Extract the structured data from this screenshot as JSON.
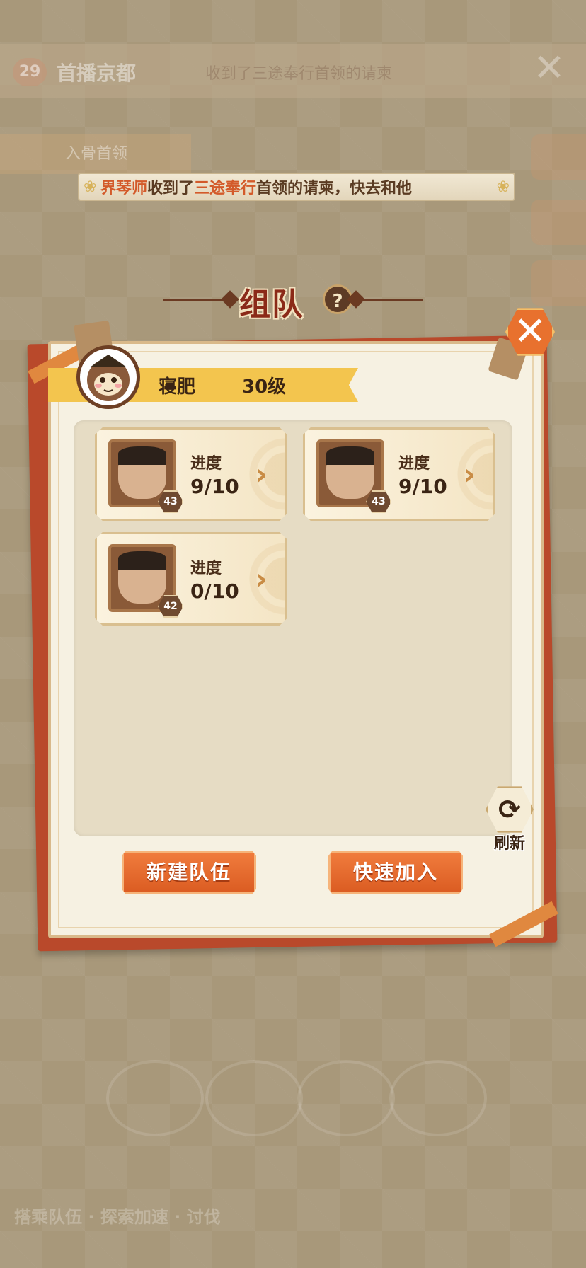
{
  "background": {
    "level": "29",
    "city": "首播京都",
    "message": "收到了三途奉行首领的请柬",
    "select_label": "入骨首领",
    "bottom_text": "搭乘队伍 · 探索加速 · 讨伐"
  },
  "notice": {
    "part1": "界琴师",
    "part2": "收到了",
    "part3": "三途奉行",
    "part4": "首领的请柬，快去和他"
  },
  "dialog": {
    "title": "组队",
    "help_icon": "?",
    "close_icon": "✕"
  },
  "player": {
    "name": "寝肥",
    "level": "30级"
  },
  "teams": [
    {
      "level": "43",
      "progress_label": "进度",
      "progress": "9/10"
    },
    {
      "level": "43",
      "progress_label": "进度",
      "progress": "9/10"
    },
    {
      "level": "42",
      "progress_label": "进度",
      "progress": "0/10"
    }
  ],
  "refresh": {
    "label": "刷新"
  },
  "buttons": {
    "new_team": "新建队伍",
    "quick_join": "快速加入"
  },
  "colors": {
    "accent": "#e8712e",
    "panel_red": "#b9492b",
    "header_yellow": "#f3c54e"
  }
}
